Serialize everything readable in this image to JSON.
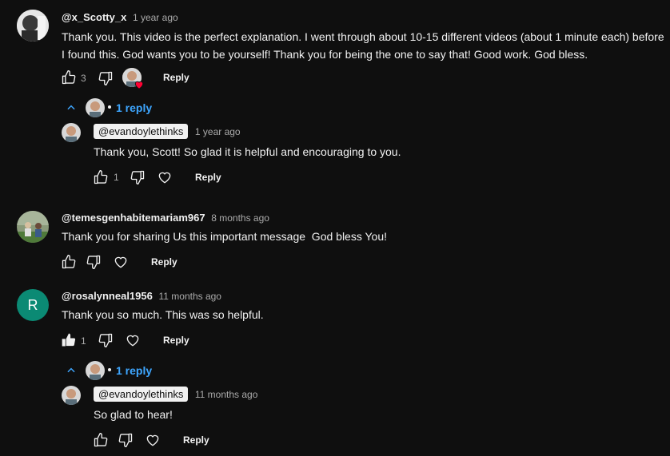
{
  "comments": [
    {
      "handle": "@x_Scotty_x",
      "time": "1 year ago",
      "text": "Thank you. This video is the perfect explanation. I went through about 10-15 different videos (about 1 minute each) before I found this. God wants you to be yourself! Thank you for being the one to say that! Good work. God bless.",
      "likes": "3",
      "reply_label": "Reply",
      "replies_label": "1 reply",
      "reply": {
        "handle": "@evandoylethinks",
        "time": "1 year ago",
        "text": "Thank you, Scott! So glad it is helpful and encouraging to you.",
        "likes": "1",
        "reply_label": "Reply"
      }
    },
    {
      "handle": "@temesgenhabitemariam967",
      "time": "8 months ago",
      "text": "Thank you for sharing Us this important message  God bless You!",
      "reply_label": "Reply"
    },
    {
      "handle": "@rosalynneal1956",
      "time": "11 months ago",
      "avatar_letter": "R",
      "avatar_color": "#0b8a74",
      "text": "Thank you so much. This was so helpful.",
      "likes": "1",
      "reply_label": "Reply",
      "replies_label": "1 reply",
      "reply": {
        "handle": "@evandoylethinks",
        "time": "11 months ago",
        "text": "So glad to hear!",
        "reply_label": "Reply"
      }
    }
  ]
}
